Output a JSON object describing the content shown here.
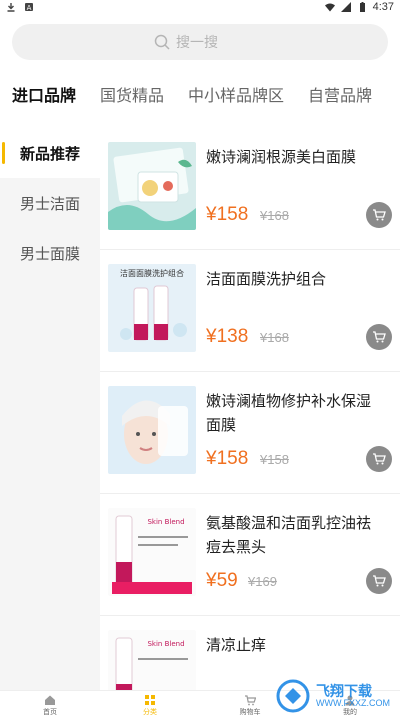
{
  "status_bar": {
    "time": "4:37"
  },
  "search": {
    "placeholder": "搜一搜"
  },
  "tabs": [
    {
      "label": "进口品牌",
      "active": true
    },
    {
      "label": "国货精品",
      "active": false
    },
    {
      "label": "中小样品牌区",
      "active": false
    },
    {
      "label": "自营品牌",
      "active": false
    }
  ],
  "sidebar": {
    "items": [
      {
        "label": "新品推荐",
        "active": true
      },
      {
        "label": "男士洁面",
        "active": false
      },
      {
        "label": "男士面膜",
        "active": false
      }
    ]
  },
  "products": [
    {
      "name": "嫩诗澜润根源美白面膜",
      "price": "¥158",
      "original_price": "¥168",
      "thumb_text": ""
    },
    {
      "name": "洁面面膜洗护组合",
      "price": "¥138",
      "original_price": "¥168",
      "thumb_text": "洁面面膜洗护组合"
    },
    {
      "name": "嫩诗澜植物修护补水保湿面膜",
      "price": "¥158",
      "original_price": "¥158",
      "thumb_text": ""
    },
    {
      "name": "氨基酸温和洁面乳控油祛痘去黑头",
      "price": "¥59",
      "original_price": "¥169",
      "thumb_text": "Skin Blend"
    },
    {
      "name": "清凉止痒",
      "price": "",
      "original_price": "",
      "thumb_text": "Skin Blend"
    }
  ],
  "bottom_nav": [
    {
      "label": "首页",
      "icon": "home-icon",
      "active": false
    },
    {
      "label": "分类",
      "icon": "category-icon",
      "active": true
    },
    {
      "label": "购物车",
      "icon": "cart-icon",
      "active": false
    },
    {
      "label": "我的",
      "icon": "user-icon",
      "active": false
    }
  ],
  "watermark": {
    "text": "飞翔下载",
    "sub": "WWW.FXXZ.COM"
  },
  "colors": {
    "accent": "#f5b800",
    "price": "#f07020",
    "sidebar_bg": "#f5f5f5",
    "search_bg": "#f0f0f0"
  }
}
